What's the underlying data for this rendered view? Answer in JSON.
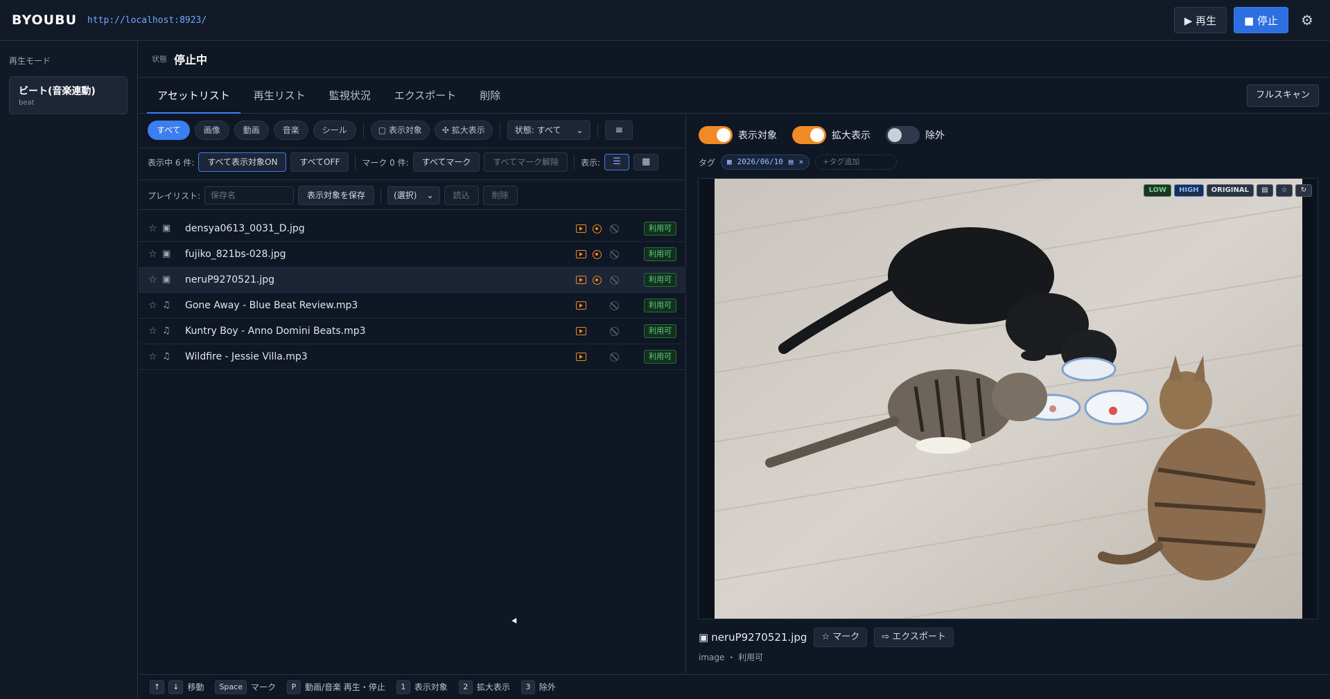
{
  "header": {
    "brand": "BYOUBU",
    "url": "http://localhost:8923/",
    "play_label": "▶ 再生",
    "stop_label": "■ 停止"
  },
  "sidebar": {
    "title": "再生モード",
    "mode_title": "ビート(音楽連動)",
    "mode_sub": "beat"
  },
  "status": {
    "label": "状態",
    "value": "停止中"
  },
  "tabs": [
    "アセットリスト",
    "再生リスト",
    "監視状況",
    "エクスポート",
    "削除"
  ],
  "fullscan_label": "フルスキャン",
  "filters": {
    "types": [
      "すべて",
      "画像",
      "動画",
      "音楽",
      "シール"
    ],
    "display_target": "▢ 表示対象",
    "zoom": "✣ 拡大表示",
    "state_select": "状態: すべて",
    "state_caret": "⌄"
  },
  "row2": {
    "showing": "表示中 6 件:",
    "all_on": "すべて表示対象ON",
    "all_off": "すべてOFF",
    "marked": "マーク 0 件:",
    "mark_all": "すべてマーク",
    "unmark_all": "すべてマーク解除",
    "view_label": "表示:"
  },
  "playlist": {
    "label": "プレイリスト:",
    "placeholder": "保存名",
    "save": "表示対象を保存",
    "select": "(選択)",
    "load": "読込",
    "delete": "削除"
  },
  "assets": [
    {
      "name": "densya0613_0031_D.jpg",
      "kind": "image",
      "status": "利用可",
      "target": true
    },
    {
      "name": "fujiko_821bs-028.jpg",
      "kind": "image",
      "status": "利用可",
      "target": true
    },
    {
      "name": "neruP9270521.jpg",
      "kind": "image",
      "status": "利用可",
      "target": true,
      "selected": true
    },
    {
      "name": "Gone Away - Blue Beat Review.mp3",
      "kind": "music",
      "status": "利用可",
      "target": false
    },
    {
      "name": "Kuntry Boy - Anno Domini Beats.mp3",
      "kind": "music",
      "status": "利用可",
      "target": false
    },
    {
      "name": "Wildfire - Jessie Villa.mp3",
      "kind": "music",
      "status": "利用可",
      "target": false
    }
  ],
  "footer": {
    "up": "↑",
    "down": "↓",
    "move": "移動",
    "space": "Space",
    "mark": "マーク",
    "p": "P",
    "play_stop": "動画/音楽 再生・停止",
    "k1": "1",
    "l1": "表示対象",
    "k2": "2",
    "l2": "拡大表示",
    "k3": "3",
    "l3": "除外"
  },
  "detail": {
    "toggle1": "表示対象",
    "toggle1_on": true,
    "toggle2": "拡大表示",
    "toggle2_on": true,
    "toggle3": "除外",
    "toggle3_on": false,
    "tag_label": "タグ",
    "tag_date": "2026/06/10",
    "tag_add": "+タグ追加",
    "quality": [
      "LOW",
      "HIGH",
      "ORIGINAL"
    ],
    "file_name": "neruP9270521.jpg",
    "mark_btn": "☆ マーク",
    "export_btn": "⇨ エクスポート",
    "meta": "image ・ 利用可"
  },
  "colors": {
    "accent": "#3b7ef0",
    "toggle_on": "#f08a24",
    "ok": "#5fd07f"
  }
}
